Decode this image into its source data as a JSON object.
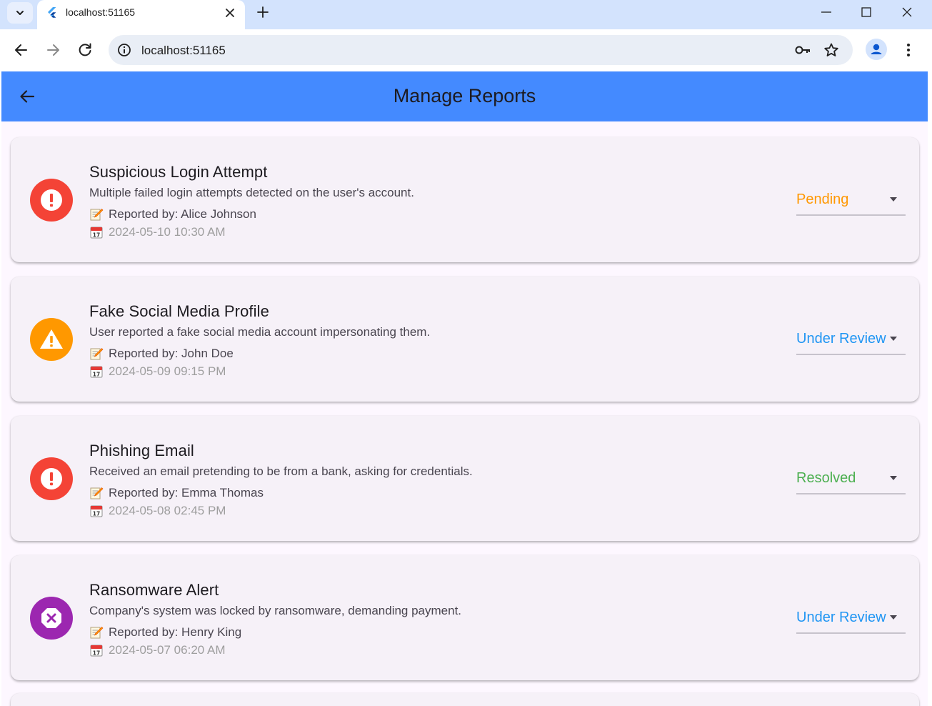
{
  "browser": {
    "tab_title": "localhost:51165",
    "url": "localhost:51165",
    "icons": {
      "tab_search": "chevron-down-icon",
      "favicon": "flutter-icon",
      "tab_close": "close-icon",
      "new_tab": "plus-icon",
      "back": "arrow-left-icon",
      "forward": "arrow-right-icon",
      "reload": "reload-icon",
      "site_info": "info-icon",
      "password": "key-icon",
      "bookmark": "star-icon",
      "profile": "person-icon",
      "menu": "more-vert-icon"
    }
  },
  "app": {
    "title": "Manage Reports",
    "accent_color": "#448aff",
    "back_icon": "arrow-left-icon"
  },
  "reports": [
    {
      "title": "Suspicious Login Attempt",
      "description": "Multiple failed login attempts detected on the user's account.",
      "reported_by": "Reported by: Alice Johnson",
      "date": "2024-05-10 10:30 AM",
      "icon": "error-icon",
      "icon_color": "#f44336",
      "status": "Pending",
      "status_color": "#ff9800"
    },
    {
      "title": "Fake Social Media Profile",
      "description": "User reported a fake social media account impersonating them.",
      "reported_by": "Reported by: John Doe",
      "date": "2024-05-09 09:15 PM",
      "icon": "warning-icon",
      "icon_color": "#ff9800",
      "status": "Under Review",
      "status_color": "#2196f3"
    },
    {
      "title": "Phishing Email",
      "description": "Received an email pretending to be from a bank, asking for credentials.",
      "reported_by": "Reported by: Emma Thomas",
      "date": "2024-05-08 02:45 PM",
      "icon": "error-icon",
      "icon_color": "#f44336",
      "status": "Resolved",
      "status_color": "#4caf50"
    },
    {
      "title": "Ransomware Alert",
      "description": "Company's system was locked by ransomware, demanding payment.",
      "reported_by": "Reported by: Henry King",
      "date": "2024-05-07 06:20 AM",
      "icon": "dangerous-icon",
      "icon_color": "#9c27b0",
      "status": "Under Review",
      "status_color": "#2196f3"
    }
  ]
}
